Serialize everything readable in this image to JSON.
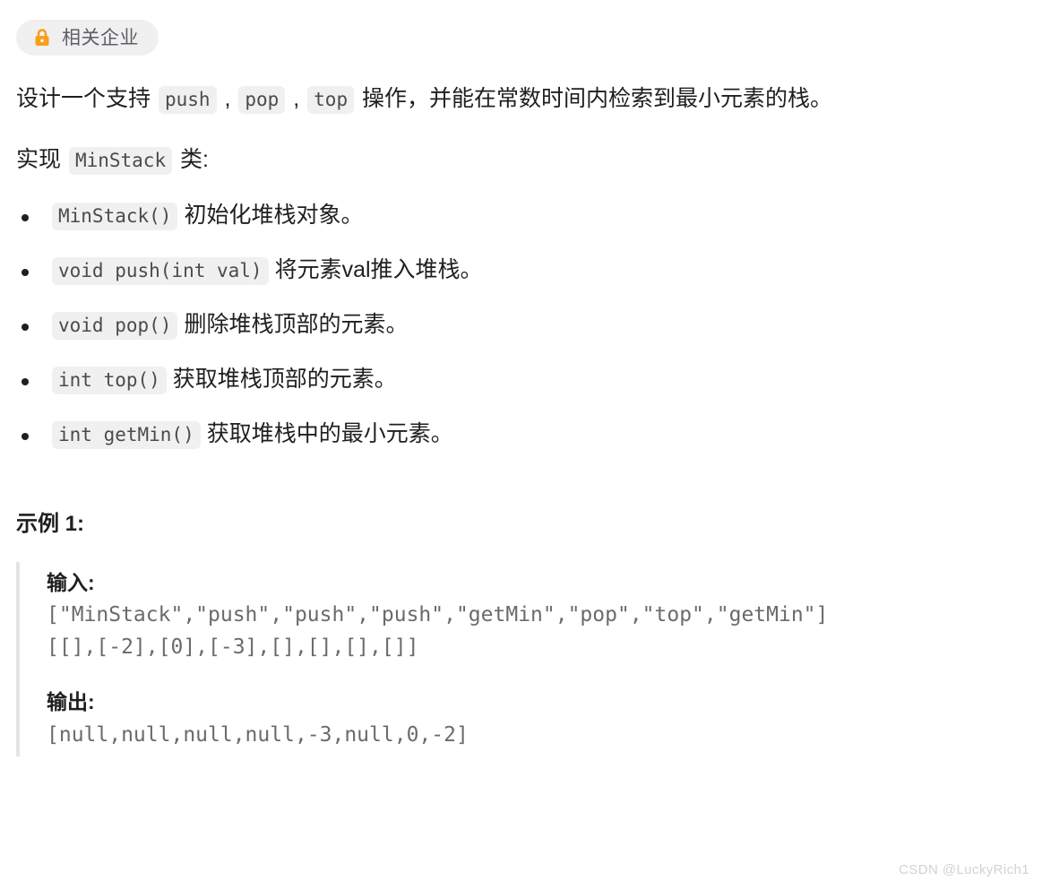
{
  "badge": {
    "icon": "lock-icon",
    "label": "相关企业",
    "background": "#f0f0f0",
    "icon_color": "#f9a01b",
    "text_color": "#5c5f66"
  },
  "intro": {
    "line1_prefix": "设计一个支持 ",
    "line1_code1": "push",
    "line1_sep1": " , ",
    "line1_code2": "pop",
    "line1_sep2": " , ",
    "line1_code3": "top",
    "line1_suffix": " 操作，并能在常数时间内检索到最小元素的栈。",
    "line2_prefix": "实现 ",
    "line2_code": "MinStack",
    "line2_suffix": " 类:"
  },
  "methods": [
    {
      "signature": "MinStack()",
      "description": "初始化堆栈对象。"
    },
    {
      "signature": "void push(int val)",
      "description": "将元素val推入堆栈。"
    },
    {
      "signature": "void pop()",
      "description": "删除堆栈顶部的元素。"
    },
    {
      "signature": "int top()",
      "description": "获取堆栈顶部的元素。"
    },
    {
      "signature": "int getMin()",
      "description": "获取堆栈中的最小元素。"
    }
  ],
  "example": {
    "title": "示例 1:",
    "input_label": "输入:",
    "input_line1": "[\"MinStack\",\"push\",\"push\",\"push\",\"getMin\",\"pop\",\"top\",\"getMin\"]",
    "input_line2": "[[],[-2],[0],[-3],[],[],[],[]]",
    "output_label": "输出:",
    "output_line1": "[null,null,null,null,-3,null,0,-2]"
  },
  "watermark": {
    "text": "CSDN @LuckyRich1"
  }
}
